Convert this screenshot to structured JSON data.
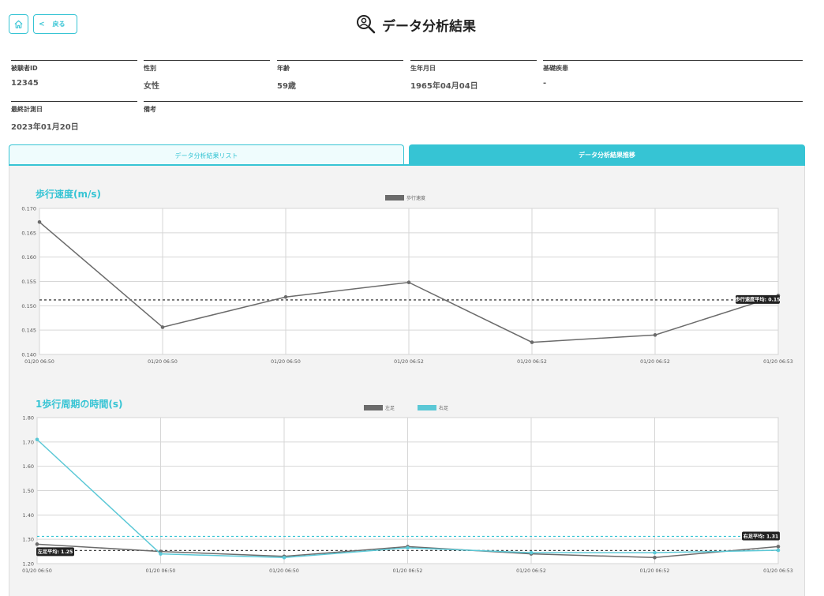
{
  "header": {
    "title": "データ分析結果",
    "back_label": "戻る"
  },
  "subject": [
    {
      "label": "被験者ID",
      "value": "12345"
    },
    {
      "label": "性別",
      "value": "女性"
    },
    {
      "label": "年齢",
      "value": "59歳"
    },
    {
      "label": "生年月日",
      "value": "1965年04月04日"
    },
    {
      "label": "基礎疾患",
      "value": "-"
    },
    {
      "label": "最終計測日",
      "value": "2023年01月20日"
    },
    {
      "label": "備考",
      "value": ""
    }
  ],
  "tabs": [
    {
      "label": "データ分析結果リスト",
      "active": false
    },
    {
      "label": "データ分析結果推移",
      "active": true
    }
  ],
  "colors": {
    "accent": "#36c4d4",
    "series_gray": "#6b6b6b",
    "series_cyan": "#5bc8d6"
  },
  "chart_data": [
    {
      "type": "line",
      "title": "歩行速度(m/s)",
      "x": [
        "01/20 06:50",
        "01/20 06:50",
        "01/20 06:50",
        "01/20 06:52",
        "01/20 06:52",
        "01/20 06:52",
        "01/20 06:53"
      ],
      "series": [
        {
          "name": "歩行速度",
          "color": "#6b6b6b",
          "values": [
            0.1672,
            0.1456,
            0.1518,
            0.1548,
            0.1425,
            0.144,
            0.1521
          ]
        }
      ],
      "ylim": [
        0.14,
        0.17
      ],
      "yticks": [
        "0.140",
        "0.145",
        "0.150",
        "0.155",
        "0.160",
        "0.165",
        "0.170"
      ],
      "averages": [
        {
          "label": "歩行速度平均: 0.15",
          "value": 0.1512,
          "color": "#444444",
          "label_side": "right"
        }
      ],
      "legend_position": "top-center",
      "grid": true
    },
    {
      "type": "line",
      "title": "1歩行周期の時間(s)",
      "x": [
        "01/20 06:50",
        "01/20 06:50",
        "01/20 06:50",
        "01/20 06:52",
        "01/20 06:52",
        "01/20 06:52",
        "01/20 06:53"
      ],
      "series": [
        {
          "name": "左足",
          "color": "#6b6b6b",
          "values": [
            1.28,
            1.25,
            1.23,
            1.27,
            1.24,
            1.225,
            1.27
          ]
        },
        {
          "name": "右足",
          "color": "#5bc8d6",
          "values": [
            1.71,
            1.24,
            1.225,
            1.265,
            1.245,
            1.245,
            1.255
          ]
        }
      ],
      "ylim": [
        1.2,
        1.8
      ],
      "yticks": [
        "1.20",
        "1.30",
        "1.40",
        "1.50",
        "1.60",
        "1.70",
        "1.80"
      ],
      "averages": [
        {
          "label": "左足平均: 1.25",
          "value": 1.254,
          "color": "#444444",
          "label_side": "left"
        },
        {
          "label": "右足平均: 1.31",
          "value": 1.312,
          "color": "#36c4d4",
          "label_side": "right"
        }
      ],
      "legend_position": "top-center",
      "grid": true
    }
  ]
}
